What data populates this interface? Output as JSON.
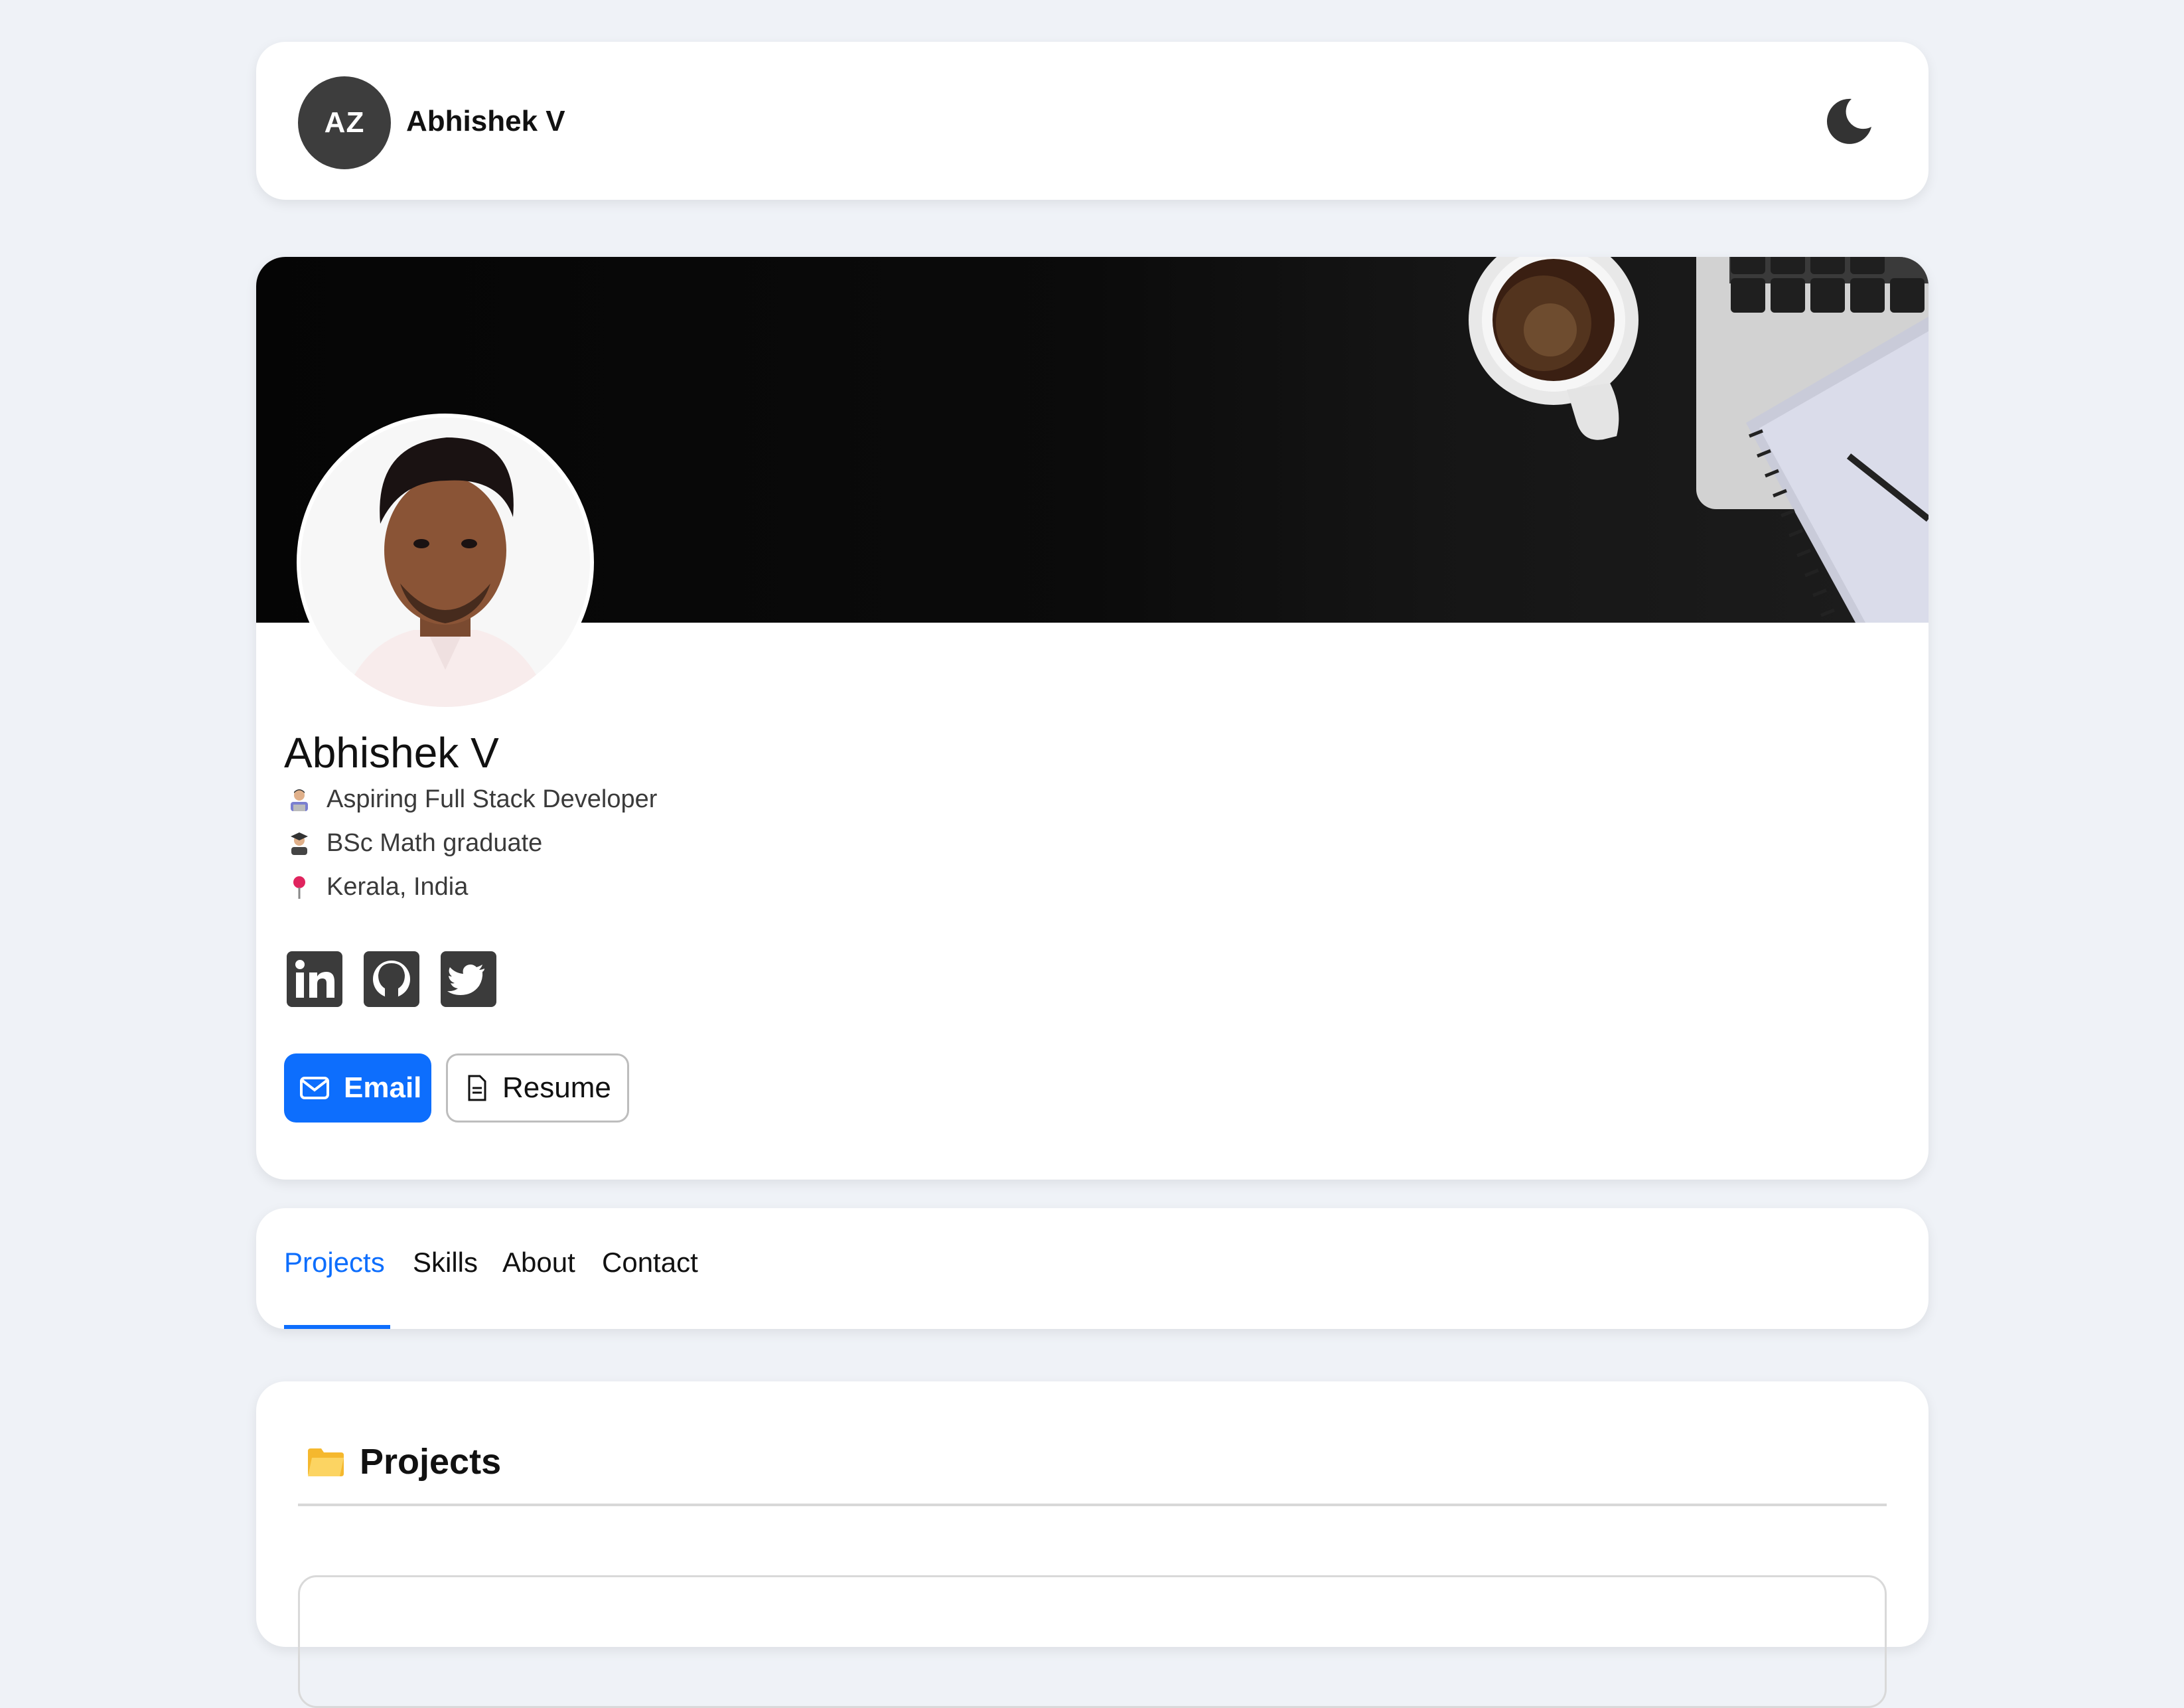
{
  "header": {
    "avatar_initials": "AZ",
    "name": "Abhishek V"
  },
  "profile": {
    "name": "Abhishek V",
    "info": [
      {
        "icon": "technologist-emoji",
        "text": "Aspiring Full Stack Developer"
      },
      {
        "icon": "graduate-emoji",
        "text": "BSc Math graduate"
      },
      {
        "icon": "pin-emoji",
        "text": "Kerala, India"
      }
    ],
    "socials": [
      "linkedin-icon",
      "github-icon",
      "twitter-icon"
    ],
    "buttons": {
      "email": "Email",
      "resume": "Resume"
    }
  },
  "tabs": [
    {
      "label": "Projects",
      "active": true
    },
    {
      "label": "Skills",
      "active": false
    },
    {
      "label": "About",
      "active": false
    },
    {
      "label": "Contact",
      "active": false
    }
  ],
  "projects": {
    "title": "Projects"
  },
  "colors": {
    "accent": "#0d6efd",
    "page_bg": "#eff2f7",
    "avatar_bg": "#3d3d3d"
  }
}
